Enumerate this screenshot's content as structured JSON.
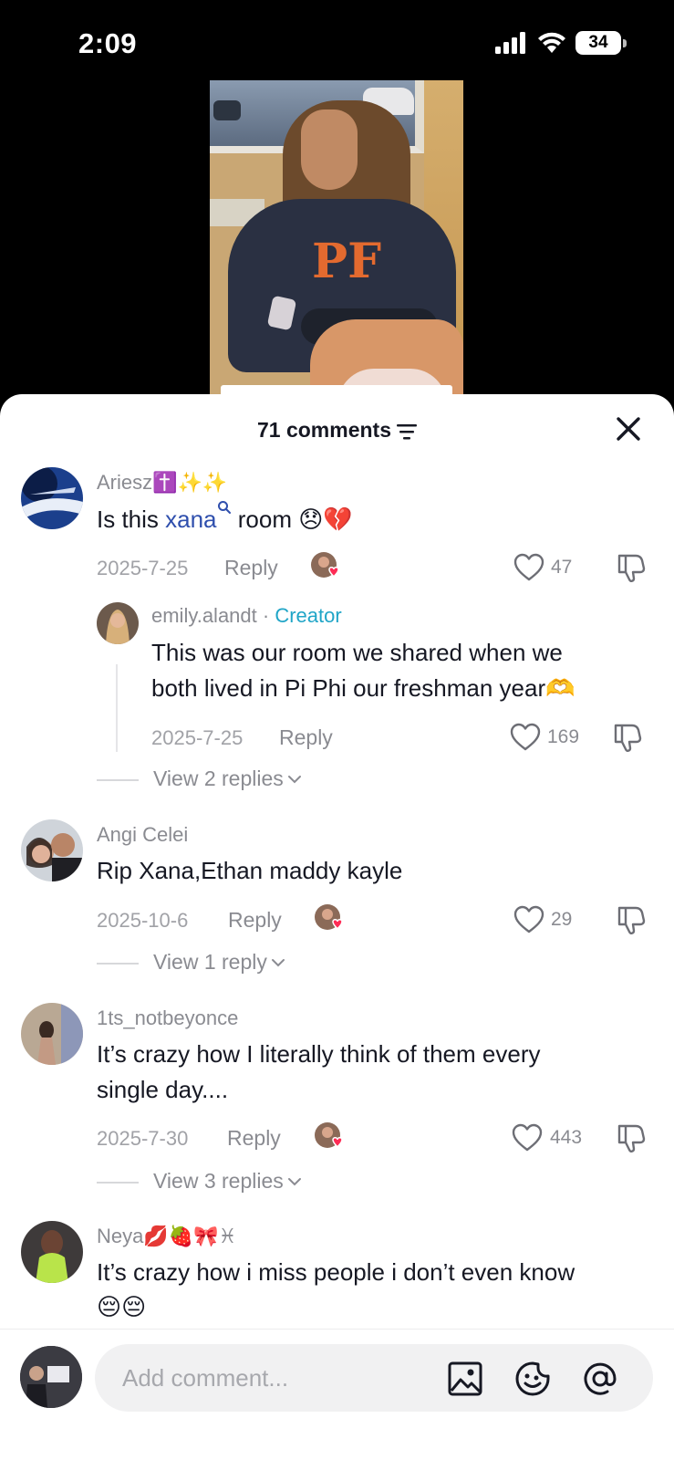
{
  "status_bar": {
    "time": "2:09",
    "battery": "34"
  },
  "sheet": {
    "comments_count": "71 comments"
  },
  "comments": [
    {
      "username": "Ariesz✝️✨✨",
      "text_before": "Is this ",
      "mention": "xana",
      "text_after": " room 😞💔",
      "date": "2025-7-25",
      "reply_label": "Reply",
      "likes": "47",
      "reply": {
        "username": "emily.alandt",
        "separator": " · ",
        "badge": "Creator",
        "text_line1": "This was our room we shared when we",
        "text_line2": "both lived in Pi Phi our freshman year🫶",
        "date": "2025-7-25",
        "reply_label": "Reply",
        "likes": "169"
      },
      "view_replies": "View 2 replies"
    },
    {
      "username": "Angi Celei",
      "text": "Rip Xana,Ethan maddy kayle",
      "date": "2025-10-6",
      "reply_label": "Reply",
      "likes": "29",
      "view_replies": "View 1 reply"
    },
    {
      "username": "1ts_notbeyonce",
      "text_line1": "It’s crazy how I literally think of them every",
      "text_line2": "single day....",
      "date": "2025-7-30",
      "reply_label": "Reply",
      "likes": "443",
      "view_replies": "View 3 replies"
    },
    {
      "username": "Neya💋🍓🎀♓",
      "text_line1": "It’s crazy how i miss people i don’t even know",
      "text_line2": "😔😔"
    }
  ],
  "composer": {
    "placeholder": "Add comment..."
  },
  "colors": {
    "mention": "#2f4fad",
    "creator": "#20a5c7",
    "like_heart": "#fe2c55"
  },
  "icons": [
    "filter-icon",
    "close-icon",
    "heart-icon",
    "dislike-icon",
    "chevron-down-icon",
    "image-icon",
    "emoji-icon",
    "at-icon",
    "search-icon"
  ]
}
